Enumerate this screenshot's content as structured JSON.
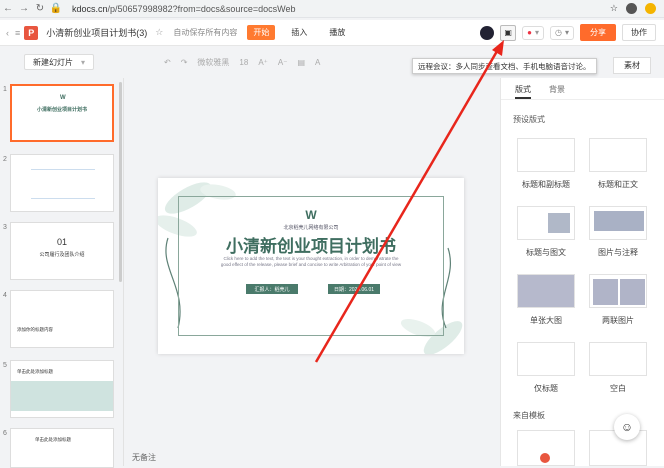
{
  "browser": {
    "url_host": "kdocs.cn",
    "url_path": "/p/50657998982?from=docs&source=docsWeb"
  },
  "app": {
    "logo_letter": "P",
    "doc_title": "小清新创业项目计划书(3)",
    "save_status": "自动保存所有内容",
    "menus": [
      "开始",
      "插入",
      "播放"
    ],
    "share_label": "分享",
    "collab_label": "协作"
  },
  "toolbar": {
    "new_slide_label": "新建幻灯片",
    "font_name": "微软雅黑",
    "font_size": "18",
    "tooltip": "远程会议：多人同步查看文档、手机电脑语音讨论。",
    "material_label": "素材"
  },
  "slides": [
    {
      "num": "1"
    },
    {
      "num": "2"
    },
    {
      "num": "3"
    },
    {
      "num": "4"
    },
    {
      "num": "5"
    },
    {
      "num": "6"
    }
  ],
  "slide": {
    "logo": "W",
    "company": "北京稻壳儿网络有限公司",
    "title": "小清新创业项目计划书",
    "subtitle": "Click here to add the text, the text is your thought extraction, in order to demonstrate the good effect of the release, please brief and concise to write Arbitration of your point of view",
    "reporter": "汇报人：稻壳儿",
    "date": "日期：2020.06.01",
    "thumb_title": "小清新创业项目计划书",
    "thumb3_num": "01",
    "thumb3_text": "公司履行及团队介绍",
    "thumb4_text": "添加你的标题内容",
    "thumb5_text": "单击此处添加标题",
    "thumb6_text": "单击此处添加标题"
  },
  "notes_placeholder": "无备注",
  "rightpanel": {
    "tabs": [
      "版式",
      "背景"
    ],
    "preset_heading": "预设版式",
    "layouts": [
      "标题和副标题",
      "标题和正文",
      "标题与图文",
      "图片与注释",
      "单张大图",
      "两联图片",
      "仅标题",
      "空白"
    ],
    "template_heading": "来自模板"
  },
  "colors": {
    "accent": "#ff6b2b",
    "slide_green": "#4a7a6b",
    "arrow_red": "#e8261c"
  }
}
